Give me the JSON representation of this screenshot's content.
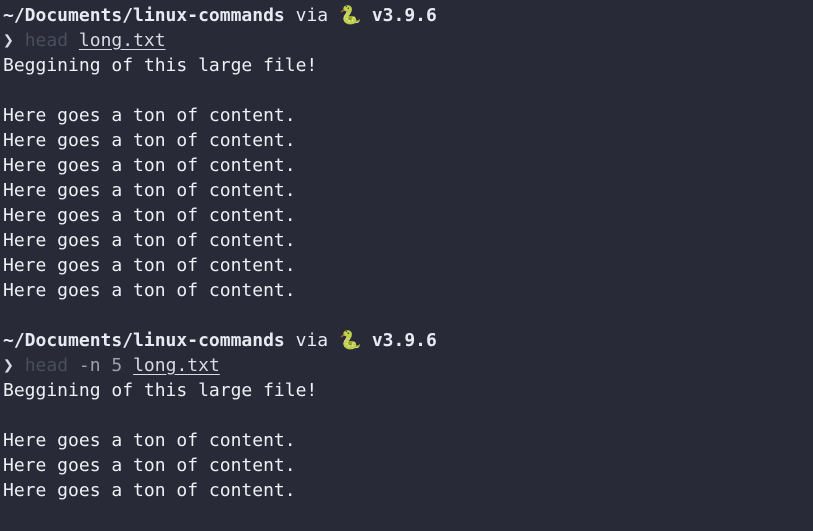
{
  "session1": {
    "path": "~/Documents/linux-commands",
    "via": "via",
    "py_icon": "python-icon",
    "version": "v3.9.6",
    "prompt_symbol": "❯",
    "command": "head",
    "args": "",
    "file": "long.txt",
    "output": [
      "Beggining of this large file!",
      "",
      "Here goes a ton of content.",
      "Here goes a ton of content.",
      "Here goes a ton of content.",
      "Here goes a ton of content.",
      "Here goes a ton of content.",
      "Here goes a ton of content.",
      "Here goes a ton of content.",
      "Here goes a ton of content."
    ]
  },
  "session2": {
    "path": "~/Documents/linux-commands",
    "via": "via",
    "py_icon": "python-icon",
    "version": "v3.9.6",
    "prompt_symbol": "❯",
    "command": "head",
    "args": "-n 5",
    "file": "long.txt",
    "output": [
      "Beggining of this large file!",
      "",
      "Here goes a ton of content.",
      "Here goes a ton of content.",
      "Here goes a ton of content."
    ]
  }
}
